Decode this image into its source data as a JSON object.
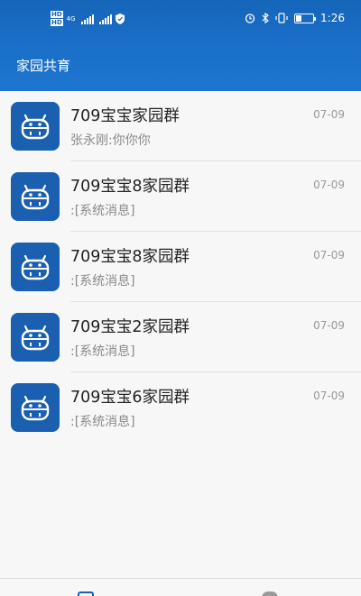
{
  "status_bar": {
    "time": "1:26",
    "network_label": "4G",
    "hd_label_1": "HD",
    "hd_label_2": "HD"
  },
  "header": {
    "title": "家园共育"
  },
  "chats": [
    {
      "name": "709宝宝家园群",
      "preview": "张永刚:你你你",
      "date": "07-09"
    },
    {
      "name": "709宝宝8家园群",
      "preview": ":[系统消息]",
      "date": "07-09"
    },
    {
      "name": "709宝宝8家园群",
      "preview": ":[系统消息]",
      "date": "07-09"
    },
    {
      "name": "709宝宝2家园群",
      "preview": ":[系统消息]",
      "date": "07-09"
    },
    {
      "name": "709宝宝6家园群",
      "preview": ":[系统消息]",
      "date": "07-09"
    }
  ],
  "icons": {
    "avatar": "robot-face-icon",
    "alarm": "alarm-icon",
    "bluetooth": "bluetooth-icon",
    "vibrate": "vibrate-icon",
    "battery": "battery-icon",
    "shield": "shield-icon"
  },
  "colors": {
    "header": "#1a6ec6",
    "avatar_bg": "#1a5fb0",
    "background": "#f7f7f7"
  }
}
